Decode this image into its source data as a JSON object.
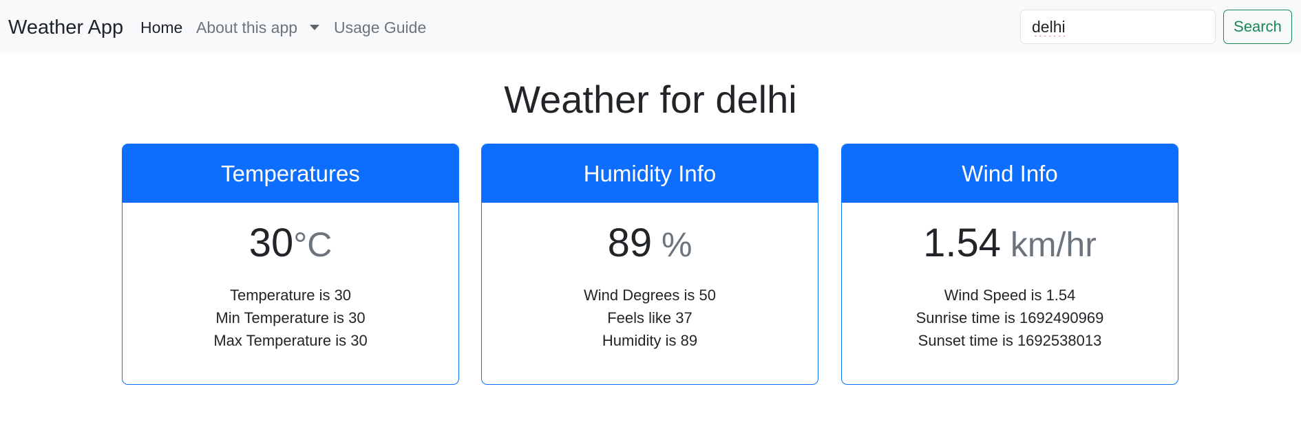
{
  "navbar": {
    "brand": "Weather App",
    "links": {
      "home": "Home",
      "about": "About this app",
      "guide": "Usage Guide"
    },
    "search": {
      "value": "delhi",
      "button_label": "Search"
    }
  },
  "main": {
    "title": "Weather for delhi",
    "cards": [
      {
        "header": "Temperatures",
        "value": "30",
        "unit": "°C",
        "lines": [
          "Temperature is 30",
          "Min Temperature is 30",
          "Max Temperature is 30"
        ]
      },
      {
        "header": "Humidity Info",
        "value": "89",
        "unit": " %",
        "lines": [
          "Wind Degrees is 50",
          "Feels like 37",
          "Humidity is 89"
        ]
      },
      {
        "header": "Wind Info",
        "value": "1.54",
        "unit": " km/hr",
        "lines": [
          "Wind Speed is 1.54",
          "Sunrise time is 1692490969",
          "Sunset time is 1692538013"
        ]
      }
    ]
  },
  "colors": {
    "primary": "#0d6efd",
    "success": "#198754",
    "navbar_bg": "#f8f9fa",
    "muted": "#6c757d"
  },
  "icons": {
    "about_dropdown": "caret-down-icon"
  }
}
